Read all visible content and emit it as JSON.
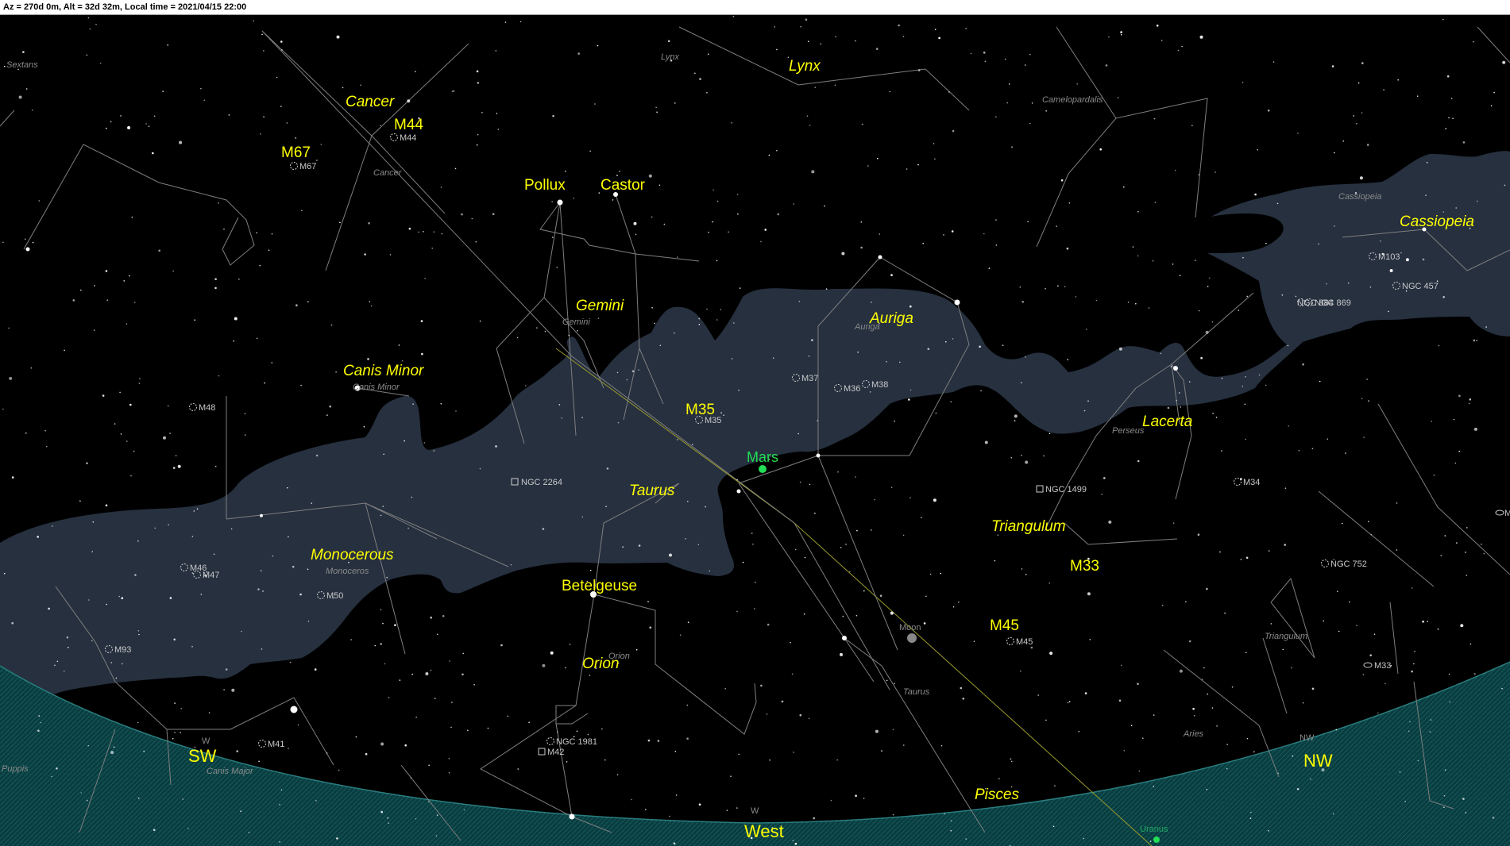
{
  "status_bar": {
    "text": "Az = 270d 0m, Alt = 32d 32m, Local time = 2021/04/15 22:00"
  },
  "colors": {
    "background": "#000000",
    "milky_way": "#26303f",
    "horizon_ground": "#0c4a4c",
    "constellation_lines": "#8a8a8a",
    "label_yellow": "#ffff00",
    "label_grey": "#8a8a8a",
    "planet_green": "#22dd55",
    "ecliptic": "#9a9a2a"
  },
  "constellation_labels": {
    "lynx": "Lynx",
    "cancer": "Cancer",
    "gemini": "Gemini",
    "canis_minor": "Canis Minor",
    "auriga": "Auriga",
    "cassiopeia": "Cassiopeia",
    "lacerta": "Lacerta",
    "taurus": "Taurus",
    "triangulum": "Triangulum",
    "monocerous": "Monocerous",
    "orion": "Orion",
    "pisces": "Pisces"
  },
  "grey_labels": {
    "lynx": "Lynx",
    "sextans": "Sextans",
    "camelopardalis": "Camelopardalis",
    "cancer": "Cancer",
    "cassiopeia": "Cassiopeia",
    "gemini": "Gemini",
    "auriga": "Auriga",
    "canis_minor": "Canis Minor",
    "perseus": "Perseus",
    "monoceros": "Monoceros",
    "orion": "Orion",
    "taurus": "Taurus",
    "triangulum": "Triangulum",
    "aries": "Aries",
    "puppis": "Puppis",
    "canis_major": "Canis Major",
    "moon": "Moon",
    "uranus": "Uranus",
    "w": "W",
    "w2": "W",
    "nw": "NW"
  },
  "star_labels": {
    "pollux": "Pollux",
    "castor": "Castor",
    "betelgeuse": "Betelgeuse"
  },
  "object_labels": {
    "m44": "M44",
    "m67": "M67",
    "m35": "M35",
    "m33": "M33",
    "m45": "M45"
  },
  "planet_labels": {
    "mars": "Mars"
  },
  "dso_labels": {
    "m44": "M44",
    "m67": "M67",
    "m103": "M103",
    "ngc457": "NGC 457",
    "ngc869": "NGC 869",
    "ngc884": "NGC 884",
    "m37": "M37",
    "m36": "M36",
    "m38": "M38",
    "m35": "M35",
    "m48": "M48",
    "ngc2264": "NGC 2264",
    "ngc1499": "NGC 1499",
    "m34": "M34",
    "ngc752": "NGC 752",
    "m46": "M46",
    "m47": "M47",
    "m50": "M50",
    "m93": "M93",
    "m45": "M45",
    "m33": "M33",
    "ngc1981": "NGC 1981",
    "m42": "M42",
    "m41": "M41",
    "m31_cut": "M"
  },
  "directions": {
    "sw": "SW",
    "west": "West",
    "nw": "NW"
  }
}
